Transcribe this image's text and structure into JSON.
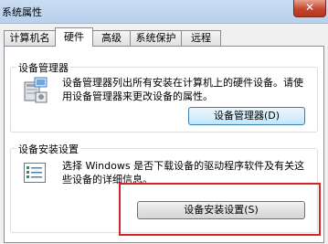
{
  "window": {
    "title": "系统属性",
    "close_glyph": "✕"
  },
  "tabs": [
    {
      "label": "计算机名",
      "active": false
    },
    {
      "label": "硬件",
      "active": true
    },
    {
      "label": "高级",
      "active": false
    },
    {
      "label": "系统保护",
      "active": false
    },
    {
      "label": "远程",
      "active": false
    }
  ],
  "device_manager": {
    "group_label": "设备管理器",
    "description": "设备管理器列出所有安装在计算机上的硬件设备。请使用设备管理器来更改设备的属性。",
    "button_label": "设备管理器(D)",
    "icon": "device-manager-icon"
  },
  "device_install": {
    "group_label": "设备安装设置",
    "description": "选择 Windows 是否下载设备的驱动程序软件及有关这些设备的详细信息。",
    "button_label": "设备安装设置(S)",
    "icon": "checklist-icon"
  },
  "colors": {
    "highlight": "#d3232b",
    "button_hot": "#bee6fd"
  }
}
